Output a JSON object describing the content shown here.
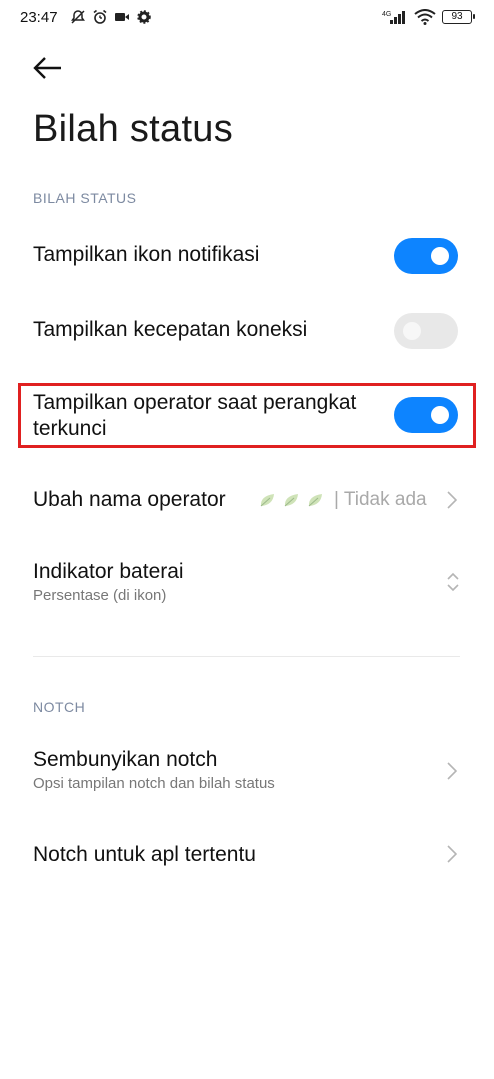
{
  "status_bar": {
    "time": "23:47",
    "network": "4G",
    "battery": "93"
  },
  "header": {
    "back_label": "",
    "title": "Bilah status"
  },
  "sections": {
    "status_label": "BILAH STATUS",
    "notch_label": "NOTCH"
  },
  "rows": {
    "notif_icons": {
      "title": "Tampilkan ikon notifikasi",
      "enabled": true
    },
    "conn_speed": {
      "title": "Tampilkan kecepatan koneksi",
      "enabled": false
    },
    "operator_lock": {
      "title_line1": "Tampilkan operator saat perangkat",
      "title_line2": "terkunci",
      "enabled": true
    },
    "rename_operator": {
      "title": "Ubah nama operator",
      "value": "| Tidak ada"
    },
    "battery_indicator": {
      "title": "Indikator baterai",
      "subtitle": "Persentase (di ikon)"
    },
    "hide_notch": {
      "title": "Sembunyikan notch",
      "subtitle": "Opsi tampilan notch dan bilah status"
    },
    "notch_apps": {
      "title": "Notch untuk apl tertentu"
    }
  },
  "colors": {
    "accent": "#0d84ff",
    "highlight": "#e02020",
    "section_label": "#7d8aa1"
  }
}
